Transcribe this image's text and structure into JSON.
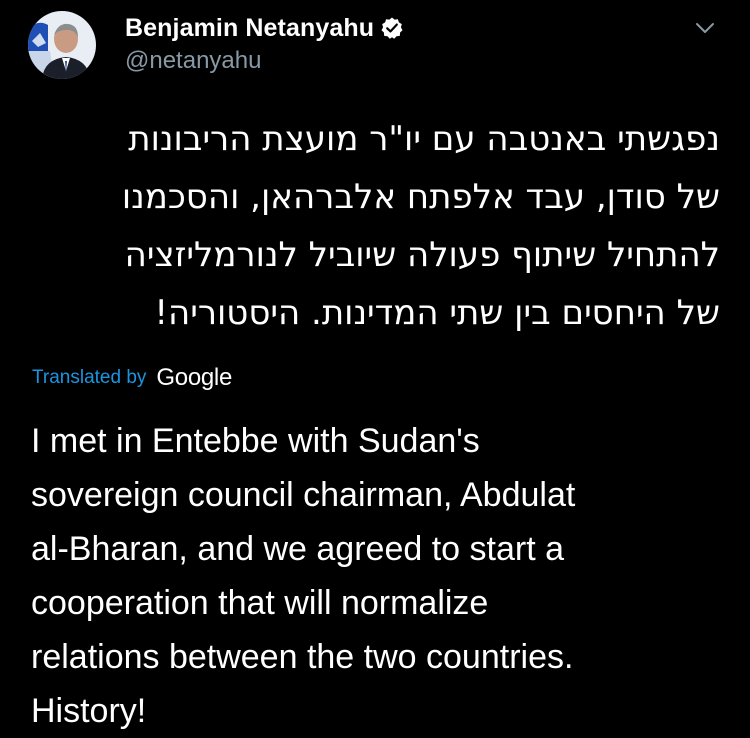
{
  "tweet": {
    "display_name": "Benjamin Netanyahu",
    "handle": "@netanyahu",
    "verified_icon": "verified-badge-icon",
    "menu_icon": "chevron-down-icon",
    "original_lines": [
      "נפגשתי באנטבה עם יו\"ר מועצת הריבונות",
      "של סודן, עבד אלפתח אלברהאן, והסכמנו",
      "להתחיל שיתוף פעולה שיוביל לנורמליזציה",
      "של היחסים בין שתי המדינות. היסטוריה!"
    ],
    "translated_by": "Translated by",
    "translation_provider": "Google",
    "translation_lines": [
      "I met in Entebbe with Sudan's",
      "sovereign council chairman, Abdulat",
      "al-Bharan, and we agreed to start a",
      "cooperation that will normalize",
      "relations between the two countries.",
      "History!"
    ]
  },
  "colors": {
    "background": "#000000",
    "text_primary": "#ffffff",
    "text_secondary": "#8899a6",
    "link_blue": "#1b95e0"
  }
}
